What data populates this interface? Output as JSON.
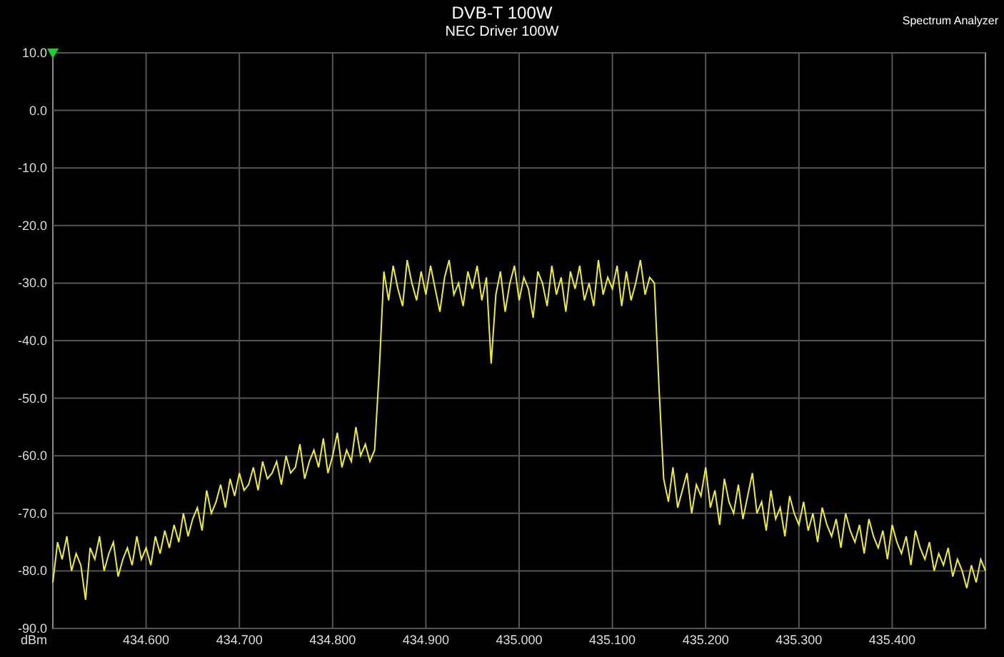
{
  "title": "DVB-T  100W",
  "subtitle": "NEC Driver 100W",
  "mode_label": "Spectrum Analyzer",
  "plot": {
    "chart_data": {
      "type": "line",
      "grid": true,
      "ylabel": "dBm",
      "xlim": [
        434.5,
        435.5
      ],
      "ylim": [
        -90,
        10
      ],
      "xticks": [
        {
          "value": 434.6,
          "label": "434.600"
        },
        {
          "value": 434.7,
          "label": "434.700"
        },
        {
          "value": 434.8,
          "label": "434.800"
        },
        {
          "value": 434.9,
          "label": "434.900"
        },
        {
          "value": 435.0,
          "label": "435.000"
        },
        {
          "value": 435.1,
          "label": "435.100"
        },
        {
          "value": 435.2,
          "label": "435.200"
        },
        {
          "value": 435.3,
          "label": "435.300"
        },
        {
          "value": 435.4,
          "label": "435.400"
        }
      ],
      "yticks": [
        {
          "value": 10,
          "label": "10.0"
        },
        {
          "value": 0,
          "label": "0.0"
        },
        {
          "value": -10,
          "label": "-10.0"
        },
        {
          "value": -20,
          "label": "-20.0"
        },
        {
          "value": -30,
          "label": "-30.0"
        },
        {
          "value": -40,
          "label": "-40.0"
        },
        {
          "value": -50,
          "label": "-50.0"
        },
        {
          "value": -60,
          "label": "-60.0"
        },
        {
          "value": -70,
          "label": "-70.0"
        },
        {
          "value": -80,
          "label": "-80.0"
        },
        {
          "value": -90,
          "label": "-90.0"
        }
      ],
      "x": [
        434.5,
        434.505,
        434.51,
        434.515,
        434.52,
        434.525,
        434.53,
        434.535,
        434.54,
        434.545,
        434.55,
        434.555,
        434.56,
        434.565,
        434.57,
        434.575,
        434.58,
        434.585,
        434.59,
        434.595,
        434.6,
        434.605,
        434.61,
        434.615,
        434.62,
        434.625,
        434.63,
        434.635,
        434.64,
        434.645,
        434.65,
        434.655,
        434.66,
        434.665,
        434.67,
        434.675,
        434.68,
        434.685,
        434.69,
        434.695,
        434.7,
        434.705,
        434.71,
        434.715,
        434.72,
        434.725,
        434.73,
        434.735,
        434.74,
        434.745,
        434.75,
        434.755,
        434.76,
        434.765,
        434.77,
        434.775,
        434.78,
        434.785,
        434.79,
        434.795,
        434.8,
        434.805,
        434.81,
        434.815,
        434.82,
        434.825,
        434.83,
        434.835,
        434.84,
        434.845,
        434.85,
        434.855,
        434.86,
        434.865,
        434.87,
        434.875,
        434.88,
        434.885,
        434.89,
        434.895,
        434.9,
        434.905,
        434.91,
        434.915,
        434.92,
        434.925,
        434.93,
        434.935,
        434.94,
        434.945,
        434.95,
        434.955,
        434.96,
        434.965,
        434.97,
        434.975,
        434.98,
        434.985,
        434.99,
        434.995,
        435.0,
        435.005,
        435.01,
        435.015,
        435.02,
        435.025,
        435.03,
        435.035,
        435.04,
        435.045,
        435.05,
        435.055,
        435.06,
        435.065,
        435.07,
        435.075,
        435.08,
        435.085,
        435.09,
        435.095,
        435.1,
        435.105,
        435.11,
        435.115,
        435.12,
        435.125,
        435.13,
        435.135,
        435.14,
        435.145,
        435.15,
        435.155,
        435.16,
        435.165,
        435.17,
        435.175,
        435.18,
        435.185,
        435.19,
        435.195,
        435.2,
        435.205,
        435.21,
        435.215,
        435.22,
        435.225,
        435.23,
        435.235,
        435.24,
        435.245,
        435.25,
        435.255,
        435.26,
        435.265,
        435.27,
        435.275,
        435.28,
        435.285,
        435.29,
        435.295,
        435.3,
        435.305,
        435.31,
        435.315,
        435.32,
        435.325,
        435.33,
        435.335,
        435.34,
        435.345,
        435.35,
        435.355,
        435.36,
        435.365,
        435.37,
        435.375,
        435.38,
        435.385,
        435.39,
        435.395,
        435.4,
        435.405,
        435.41,
        435.415,
        435.42,
        435.425,
        435.43,
        435.435,
        435.44,
        435.445,
        435.45,
        435.455,
        435.46,
        435.465,
        435.47,
        435.475,
        435.48,
        435.485,
        435.49,
        435.495,
        435.5
      ],
      "series": [
        {
          "color": "#f0f020",
          "values": [
            -82,
            -75,
            -78,
            -74,
            -80,
            -77,
            -79,
            -85,
            -76,
            -78,
            -74,
            -80,
            -77,
            -75,
            -81,
            -78,
            -76,
            -79,
            -74,
            -78,
            -76,
            -79,
            -74,
            -77,
            -73,
            -76,
            -72,
            -75,
            -70,
            -74,
            -71,
            -69,
            -73,
            -66,
            -70,
            -68,
            -65,
            -69,
            -64,
            -67,
            -63,
            -66,
            -65,
            -62,
            -66,
            -61,
            -64,
            -63,
            -61,
            -65,
            -60,
            -63,
            -62,
            -58,
            -64,
            -61,
            -59,
            -62,
            -57,
            -63,
            -60,
            -56,
            -62,
            -59,
            -61,
            -55,
            -60,
            -58,
            -61,
            -59,
            -45,
            -28,
            -33,
            -27,
            -31,
            -34,
            -26,
            -30,
            -33,
            -28,
            -32,
            -27,
            -31,
            -35,
            -29,
            -26,
            -32,
            -30,
            -34,
            -28,
            -31,
            -27,
            -33,
            -29,
            -44,
            -32,
            -28,
            -35,
            -30,
            -27,
            -33,
            -29,
            -31,
            -36,
            -28,
            -30,
            -34,
            -27,
            -32,
            -29,
            -35,
            -28,
            -31,
            -27,
            -33,
            -30,
            -34,
            -26,
            -32,
            -29,
            -31,
            -27,
            -34,
            -28,
            -33,
            -30,
            -26,
            -32,
            -29,
            -30,
            -48,
            -64,
            -68,
            -62,
            -69,
            -66,
            -63,
            -70,
            -65,
            -67,
            -62,
            -69,
            -66,
            -72,
            -64,
            -68,
            -70,
            -65,
            -71,
            -67,
            -63,
            -70,
            -68,
            -73,
            -66,
            -71,
            -69,
            -74,
            -67,
            -70,
            -72,
            -68,
            -73,
            -70,
            -75,
            -69,
            -72,
            -74,
            -71,
            -76,
            -70,
            -73,
            -75,
            -72,
            -77,
            -71,
            -74,
            -76,
            -73,
            -78,
            -72,
            -75,
            -77,
            -74,
            -79,
            -73,
            -76,
            -78,
            -75,
            -80,
            -77,
            -79,
            -76,
            -81,
            -78,
            -80,
            -83,
            -79,
            -82,
            -78,
            -80
          ]
        }
      ]
    }
  }
}
